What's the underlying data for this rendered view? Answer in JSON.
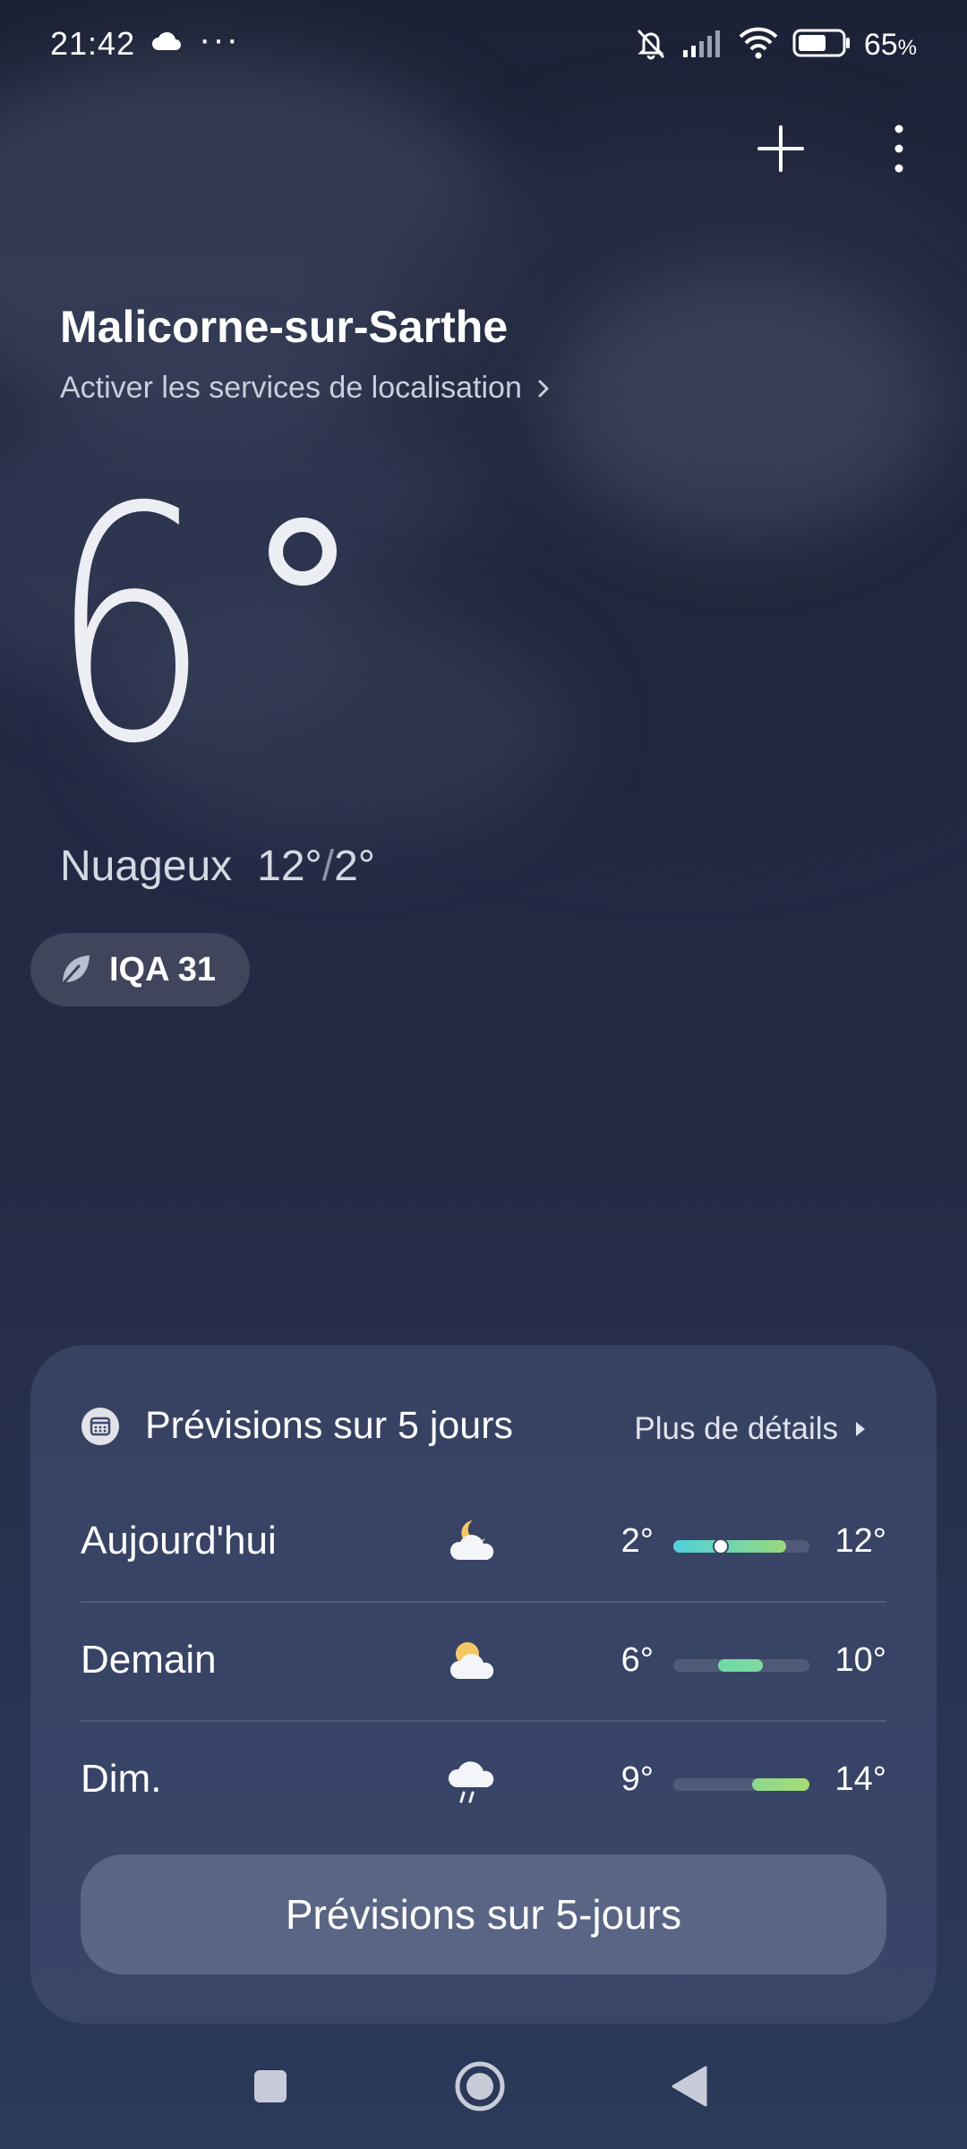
{
  "status_bar": {
    "time": "21:42",
    "dots": "···",
    "battery_percent": "65",
    "battery_unit": "%",
    "battery_level": 0.65
  },
  "location": {
    "city": "Malicorne-sur-Sarthe",
    "enable_location_label": "Activer les services de localisation"
  },
  "current": {
    "temperature": "6",
    "condition": "Nuageux",
    "high": "12°",
    "separator": "/",
    "low": "2°"
  },
  "aqi": {
    "label": "IQA 31",
    "icon": "leaf-icon"
  },
  "forecast_card": {
    "title": "Prévisions sur 5 jours",
    "more_label": "Plus de détails",
    "days": [
      {
        "day": "Aujourd'hui",
        "icon": "moon-cloud-icon",
        "min": "2°",
        "max": "12°",
        "bar_start": 0.0,
        "bar_end": 0.83,
        "current_marker": 0.35,
        "gradient": [
          "#4fd1d9",
          "#6fd6b0",
          "#9bd87a"
        ]
      },
      {
        "day": "Demain",
        "icon": "sun-cloud-icon",
        "min": "6°",
        "max": "10°",
        "bar_start": 0.33,
        "bar_end": 0.66,
        "gradient": [
          "#6fd9a8",
          "#7fdba0"
        ]
      },
      {
        "day": "Dim.",
        "icon": "rain-cloud-icon",
        "min": "9°",
        "max": "14°",
        "bar_start": 0.58,
        "bar_end": 1.0,
        "gradient": [
          "#8cd890",
          "#a6dc74"
        ]
      }
    ],
    "cta_label": "Prévisions sur 5-jours"
  },
  "colors": {
    "background_top": "#1c2236",
    "background_bottom": "#2b3a5a",
    "card": "#465276"
  }
}
